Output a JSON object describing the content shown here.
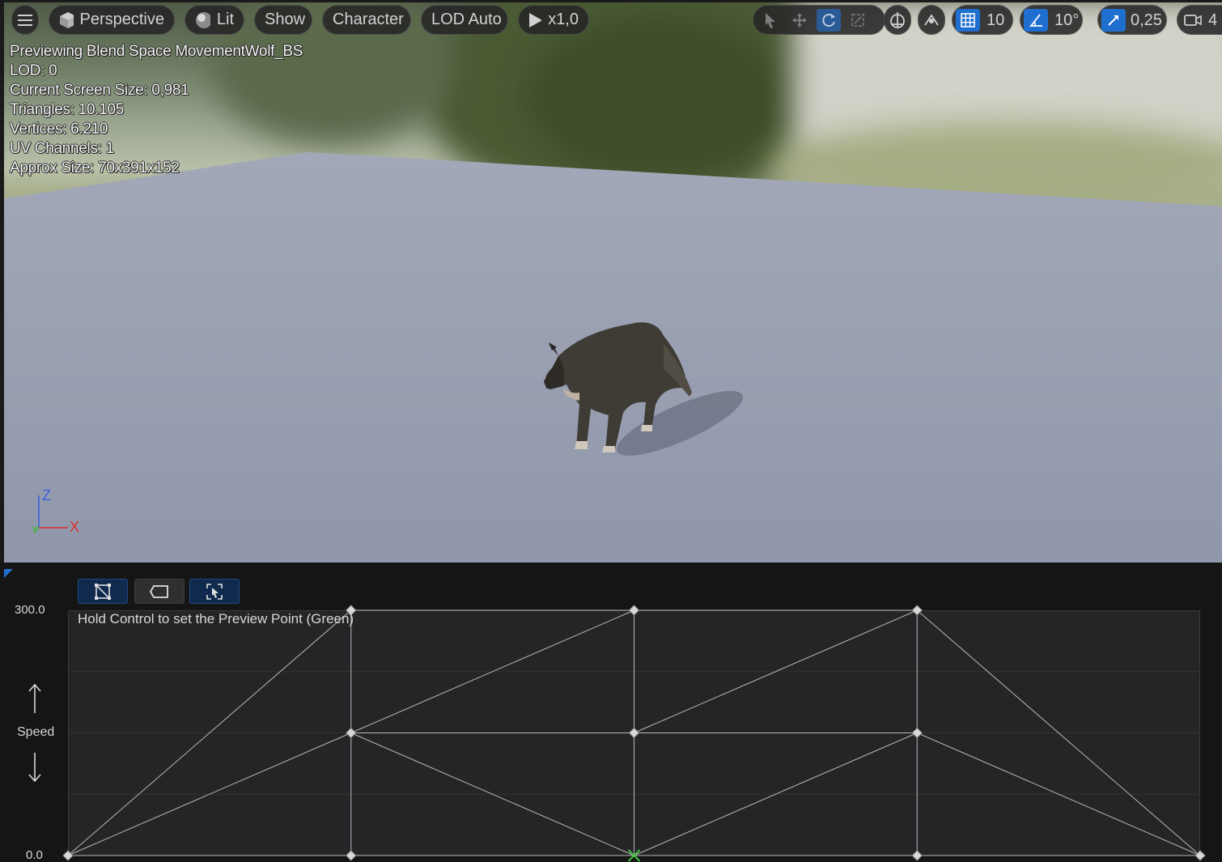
{
  "toolbar": {
    "menu_icon": "hamburger-icon",
    "perspective_label": "Perspective",
    "lit_label": "Lit",
    "show_label": "Show",
    "character_label": "Character",
    "lod_label": "LOD Auto",
    "play_speed_label": "x1,0",
    "grid_snap_value": "10",
    "rotation_snap_value": "10°",
    "scale_snap_value": "0,25",
    "camera_speed_value": "4",
    "accent_color": "#1f6fd1"
  },
  "stats": {
    "line1": "Previewing Blend Space MovementWolf_BS",
    "line2": "LOD: 0",
    "line3": "Current Screen Size: 0,981",
    "line4": "Triangles: 10.105",
    "line5": "Vertices: 6.210",
    "line6": "UV Channels: 1",
    "line7": "Approx Size: 70x391x152"
  },
  "axis_gizmo": {
    "z_label": "Z",
    "x_label": "X",
    "y_label": "Y"
  },
  "blend_space": {
    "hint": "Hold Control to set the Preview Point (Green)",
    "y_axis_name": "Speed",
    "y_max_label": "300.0",
    "y_min_label": "0.0",
    "y_range": [
      0,
      300
    ],
    "x_range": [
      -180,
      180
    ],
    "sample_points": [
      {
        "x": -180,
        "y": 0
      },
      {
        "x": -90,
        "y": 0
      },
      {
        "x": 90,
        "y": 0
      },
      {
        "x": 180,
        "y": 0
      },
      {
        "x": -90,
        "y": 150
      },
      {
        "x": 0,
        "y": 150
      },
      {
        "x": 90,
        "y": 150
      },
      {
        "x": -90,
        "y": 300
      },
      {
        "x": 0,
        "y": 300
      },
      {
        "x": 90,
        "y": 300
      }
    ],
    "preview_point": {
      "x": 0,
      "y": 0
    },
    "triangles": [
      [
        [
          -180,
          0
        ],
        [
          -90,
          0
        ],
        [
          -90,
          150
        ]
      ],
      [
        [
          -180,
          0
        ],
        [
          -90,
          150
        ],
        [
          -90,
          300
        ]
      ],
      [
        [
          -90,
          0
        ],
        [
          -90,
          150
        ],
        [
          0,
          0
        ]
      ],
      [
        [
          -90,
          150
        ],
        [
          0,
          150
        ],
        [
          0,
          0
        ]
      ],
      [
        [
          -90,
          150
        ],
        [
          -90,
          300
        ],
        [
          0,
          300
        ]
      ],
      [
        [
          -90,
          150
        ],
        [
          0,
          300
        ],
        [
          0,
          150
        ]
      ],
      [
        [
          0,
          0
        ],
        [
          0,
          150
        ],
        [
          90,
          150
        ]
      ],
      [
        [
          0,
          0
        ],
        [
          90,
          150
        ],
        [
          90,
          0
        ]
      ],
      [
        [
          0,
          150
        ],
        [
          0,
          300
        ],
        [
          90,
          300
        ]
      ],
      [
        [
          0,
          150
        ],
        [
          90,
          300
        ],
        [
          90,
          150
        ]
      ],
      [
        [
          90,
          0
        ],
        [
          90,
          150
        ],
        [
          180,
          0
        ]
      ],
      [
        [
          90,
          150
        ],
        [
          90,
          300
        ],
        [
          180,
          0
        ]
      ]
    ]
  }
}
